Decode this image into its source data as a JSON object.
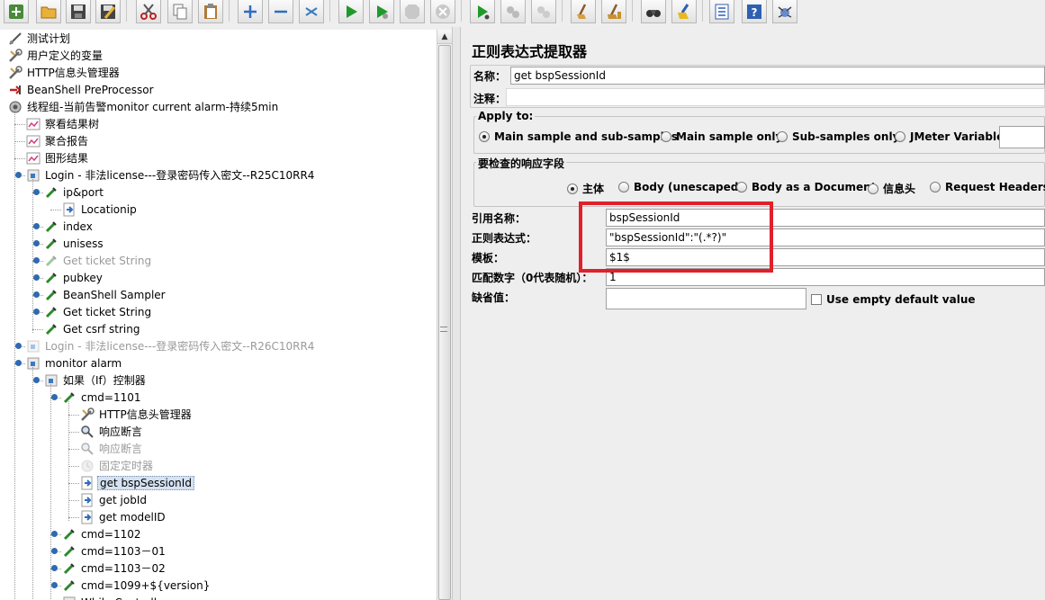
{
  "toolbar": {
    "buttons": [
      {
        "icon": "templates-icon"
      },
      {
        "icon": "open-icon"
      },
      {
        "icon": "save-icon"
      },
      {
        "icon": "save-as-icon"
      },
      {
        "icon": "cut-icon"
      },
      {
        "icon": "copy-icon"
      },
      {
        "icon": "paste-icon"
      },
      {
        "icon": "expand-icon"
      },
      {
        "icon": "collapse-icon"
      },
      {
        "icon": "toggle-icon"
      },
      {
        "icon": "start-icon"
      },
      {
        "icon": "start-no-pause-icon"
      },
      {
        "icon": "stop-icon"
      },
      {
        "icon": "shutdown-icon"
      },
      {
        "icon": "remote-start-icon"
      },
      {
        "icon": "remote-stop-icon"
      },
      {
        "icon": "remote-shutdown-icon"
      },
      {
        "icon": "clear-icon"
      },
      {
        "icon": "clear-all-icon"
      },
      {
        "icon": "search-icon"
      },
      {
        "icon": "reset-search-icon"
      },
      {
        "icon": "function-helper-icon"
      },
      {
        "icon": "help-icon"
      },
      {
        "icon": "logger-icon"
      }
    ]
  },
  "tree": {
    "nodes": [
      {
        "label": "测试计划",
        "icon": "test-plan-icon",
        "disabled": false
      },
      {
        "label": "用户定义的变量",
        "icon": "wrench-icon",
        "disabled": false
      },
      {
        "label": "HTTP信息头管理器",
        "icon": "wrench-icon",
        "disabled": false
      },
      {
        "label": "BeanShell PreProcessor",
        "icon": "preprocessor-icon",
        "disabled": false
      },
      {
        "label": "线程组-当前告警monitor current alarm-持续5min",
        "icon": "thread-group-icon",
        "disabled": false
      },
      {
        "label": "察看结果树",
        "icon": "listener-icon",
        "disabled": false
      },
      {
        "label": "聚合报告",
        "icon": "listener-icon",
        "disabled": false
      },
      {
        "label": "图形结果",
        "icon": "listener-icon",
        "disabled": false
      },
      {
        "label": "Login - 非法license---登录密码传入密文--R25C10RR4",
        "icon": "controller-icon",
        "disabled": false
      },
      {
        "label": "ip&port",
        "icon": "sampler-icon",
        "disabled": false
      },
      {
        "label": "Locationip",
        "icon": "extractor-icon",
        "disabled": false
      },
      {
        "label": "index",
        "icon": "sampler-icon",
        "disabled": false
      },
      {
        "label": "unisess",
        "icon": "sampler-icon",
        "disabled": false
      },
      {
        "label": "Get  ticket  String",
        "icon": "sampler-icon",
        "disabled": true
      },
      {
        "label": "pubkey",
        "icon": "sampler-icon",
        "disabled": false
      },
      {
        "label": "BeanShell Sampler",
        "icon": "sampler-icon",
        "disabled": false
      },
      {
        "label": "Get  ticket  String",
        "icon": "sampler-icon",
        "disabled": false
      },
      {
        "label": "Get csrf  string",
        "icon": "sampler-icon",
        "disabled": false
      },
      {
        "label": "Login - 非法license---登录密码传入密文--R26C10RR4",
        "icon": "controller-icon",
        "disabled": true
      },
      {
        "label": "monitor alarm",
        "icon": "controller-icon",
        "disabled": false
      },
      {
        "label": "如果（If）控制器",
        "icon": "controller-icon",
        "disabled": false
      },
      {
        "label": "cmd=1101",
        "icon": "sampler-icon",
        "disabled": false
      },
      {
        "label": "HTTP信息头管理器",
        "icon": "wrench-icon",
        "disabled": false
      },
      {
        "label": "响应断言",
        "icon": "assertion-icon",
        "disabled": false
      },
      {
        "label": "响应断言",
        "icon": "assertion-icon",
        "disabled": true
      },
      {
        "label": "固定定时器",
        "icon": "timer-icon",
        "disabled": true
      },
      {
        "label": "get bspSessionId",
        "icon": "extractor-icon",
        "disabled": false,
        "selected": true
      },
      {
        "label": "get jobId",
        "icon": "extractor-icon",
        "disabled": false
      },
      {
        "label": "get modelID",
        "icon": "extractor-icon",
        "disabled": false
      },
      {
        "label": "cmd=1102",
        "icon": "sampler-icon",
        "disabled": false
      },
      {
        "label": "cmd=1103－01",
        "icon": "sampler-icon",
        "disabled": false
      },
      {
        "label": "cmd=1103－02",
        "icon": "sampler-icon",
        "disabled": false
      },
      {
        "label": "cmd=1099+${version}",
        "icon": "sampler-icon",
        "disabled": false
      },
      {
        "label": "While Controller",
        "icon": "controller-icon",
        "disabled": false
      }
    ]
  },
  "panel": {
    "title": "正则表达式提取器",
    "name_label": "名称：",
    "name_value": "get bspSessionId",
    "comment_label": "注释：",
    "comment_value": "",
    "apply_to": {
      "title": "Apply to:",
      "options": [
        "Main sample and sub-samples",
        "Main sample only",
        "Sub-samples only",
        "JMeter Variable"
      ],
      "selected": "Main sample and sub-samples",
      "variable_value": ""
    },
    "field_to_check": {
      "title": "要检查的响应字段",
      "options": [
        "主体",
        "Body (unescaped)",
        "Body as a Document",
        "信息头",
        "Request Headers"
      ],
      "selected": "主体"
    },
    "reference_name_label": "引用名称：",
    "reference_name_value": "bspSessionId",
    "regex_label": "正则表达式：",
    "regex_value": "\"bspSessionId\":\"(.*?)\"",
    "template_label": "模板：",
    "template_value": "$1$",
    "match_no_label": "匹配数字（0代表随机）：",
    "match_no_value": "1",
    "default_label": "缺省值：",
    "default_value": "",
    "use_empty_label": "Use empty default value",
    "use_empty_checked": false
  },
  "colors": {
    "highlight": "#e0202a",
    "selection": "#d5e2f2"
  }
}
